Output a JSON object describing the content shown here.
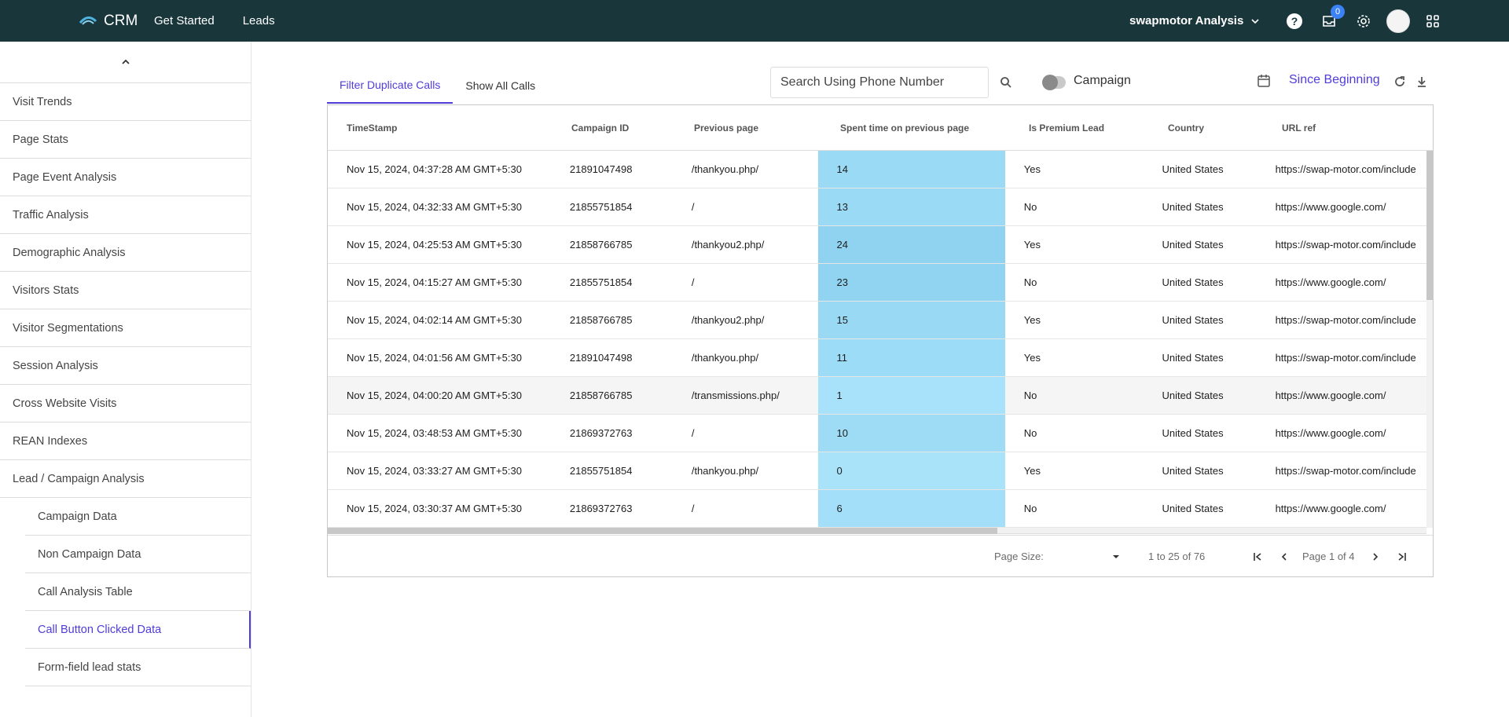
{
  "topbar": {
    "brand": "CRM",
    "nav": [
      "Get Started",
      "Leads"
    ],
    "account": "swapmotor Analysis",
    "notifications_count": "0"
  },
  "sidebar": {
    "items": [
      "Visit Trends",
      "Page Stats",
      "Page Event Analysis",
      "Traffic Analysis",
      "Demographic Analysis",
      "Visitors Stats",
      "Visitor Segmentations",
      "Session Analysis",
      "Cross Website Visits",
      "REAN Indexes",
      "Lead / Campaign Analysis"
    ],
    "subitems": [
      "Campaign Data",
      "Non Campaign Data",
      "Call Analysis Table",
      "Call Button Clicked Data",
      "Form-field lead stats"
    ]
  },
  "tabs": [
    "Filter Duplicate Calls",
    "Show All Calls"
  ],
  "search": {
    "placeholder": "Search Using Phone Number"
  },
  "toggle_label": "Campaign",
  "date_range": "Since Beginning",
  "table": {
    "columns": [
      "TimeStamp",
      "Campaign ID",
      "Previous page",
      "Spent time on previous page",
      "Is Premium Lead",
      "Country",
      "URL ref"
    ],
    "rows": [
      [
        "Nov 15, 2024, 04:37:28 AM GMT+5:30",
        "21891047498",
        "/thankyou.php/",
        "14",
        "Yes",
        "United States",
        "https://swap-motor.com/include"
      ],
      [
        "Nov 15, 2024, 04:32:33 AM GMT+5:30",
        "21855751854",
        "/",
        "13",
        "No",
        "United States",
        "https://www.google.com/"
      ],
      [
        "Nov 15, 2024, 04:25:53 AM GMT+5:30",
        "21858766785",
        "/thankyou2.php/",
        "24",
        "Yes",
        "United States",
        "https://swap-motor.com/include"
      ],
      [
        "Nov 15, 2024, 04:15:27 AM GMT+5:30",
        "21855751854",
        "/",
        "23",
        "No",
        "United States",
        "https://www.google.com/"
      ],
      [
        "Nov 15, 2024, 04:02:14 AM GMT+5:30",
        "21858766785",
        "/thankyou2.php/",
        "15",
        "Yes",
        "United States",
        "https://swap-motor.com/include"
      ],
      [
        "Nov 15, 2024, 04:01:56 AM GMT+5:30",
        "21891047498",
        "/thankyou.php/",
        "11",
        "Yes",
        "United States",
        "https://swap-motor.com/include"
      ],
      [
        "Nov 15, 2024, 04:00:20 AM GMT+5:30",
        "21858766785",
        "/transmissions.php/",
        "1",
        "No",
        "United States",
        "https://www.google.com/"
      ],
      [
        "Nov 15, 2024, 03:48:53 AM GMT+5:30",
        "21869372763",
        "/",
        "10",
        "No",
        "United States",
        "https://www.google.com/"
      ],
      [
        "Nov 15, 2024, 03:33:27 AM GMT+5:30",
        "21855751854",
        "/thankyou.php/",
        "0",
        "Yes",
        "United States",
        "https://swap-motor.com/include"
      ],
      [
        "Nov 15, 2024, 03:30:37 AM GMT+5:30",
        "21869372763",
        "/",
        "6",
        "No",
        "United States",
        "https://www.google.com/"
      ]
    ]
  },
  "pager": {
    "page_size_label": "Page Size:",
    "summary": "1 to 25 of 76",
    "page_text": "Page 1 of 4"
  },
  "colors": {
    "topbar": "#19363b",
    "accent": "#4f3cd9",
    "heat_low": "#a9e3fa",
    "heat_high": "#8fd3f1"
  }
}
